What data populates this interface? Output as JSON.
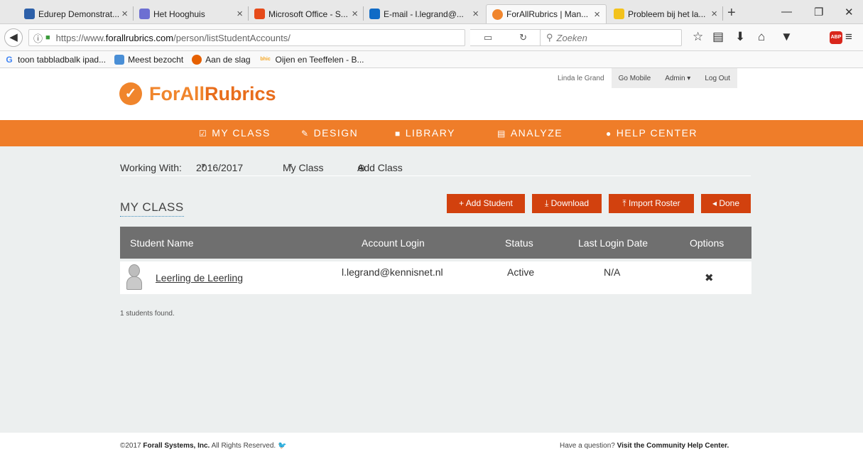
{
  "browser": {
    "tabs": [
      {
        "title": "Edurep Demonstrat...",
        "icon": "edurep-icon",
        "color": "#2c5fa8"
      },
      {
        "title": "Het Hooghuis",
        "icon": "hooghuis-icon",
        "color": "#6d6fd2"
      },
      {
        "title": "Microsoft Office - S...",
        "icon": "office-icon",
        "color": "#e64a19"
      },
      {
        "title": "E-mail - l.legrand@...",
        "icon": "outlook-icon",
        "color": "#0f6bc6"
      },
      {
        "title": "ForAllRubrics | Man...",
        "icon": "forallrubrics-icon",
        "color": "#f0852c"
      },
      {
        "title": "Probleem bij het la...",
        "icon": "warning-icon",
        "color": "#f3c21c"
      }
    ],
    "new_tab": "+",
    "url_prefix": "https://www.",
    "url_domain": "forallrubrics.com",
    "url_path": "/person/listStudentAccounts/",
    "search_placeholder": "Zoeken",
    "abp_label": "ABP",
    "bookmarks": [
      {
        "label": "toon tabbladbalk ipad...",
        "icon": "google-icon",
        "glyph": "G",
        "color": "#4285f4"
      },
      {
        "label": "Meest bezocht",
        "icon": "most-visited-icon",
        "glyph": "",
        "color": "#4a8fd6"
      },
      {
        "label": "Aan de slag",
        "icon": "firefox-icon",
        "glyph": "",
        "color": "#e66000"
      },
      {
        "label": "Oijen en Teeffelen - B...",
        "icon": "bhic-icon",
        "glyph": "bhic",
        "color": "#f5a623"
      }
    ]
  },
  "site": {
    "logo_part1": "ForAll",
    "logo_part2": "Rubrics",
    "user_name": "Linda le Grand",
    "go_mobile": "Go Mobile",
    "admin": "Admin ▾",
    "log_out": "Log Out",
    "nav": [
      {
        "label": "MY CLASS",
        "icon": "checkbox-icon",
        "glyph": "☑"
      },
      {
        "label": "DESIGN",
        "icon": "pencil-icon",
        "glyph": "✎"
      },
      {
        "label": "LIBRARY",
        "icon": "book-icon",
        "glyph": "■"
      },
      {
        "label": "ANALYZE",
        "icon": "bar-chart-icon",
        "glyph": "▤"
      },
      {
        "label": "HELP CENTER",
        "icon": "chat-bubbles-icon",
        "glyph": "●"
      }
    ],
    "accent": "#ef7d29",
    "button_color": "#d2410e"
  },
  "toolbar": {
    "working_with_label": "Working With:",
    "year": "2016/2017",
    "class_select": "My Class",
    "add_class": "Add Class"
  },
  "section_title": "MY CLASS",
  "actions": {
    "add_student": "+ Add Student",
    "download": "⤓ Download",
    "import_roster": "⤒ Import Roster",
    "done": "◂ Done"
  },
  "table": {
    "columns": [
      "Student Name",
      "Account Login",
      "Status",
      "Last Login Date",
      "Options"
    ],
    "rows": [
      {
        "name": "Leerling de Leerling",
        "login": "l.legrand@kennisnet.nl",
        "status": "Active",
        "last_login": "N/A",
        "option": "✖"
      }
    ]
  },
  "count_text": "1 students found.",
  "footer": {
    "copyright_prefix": "©2017 ",
    "company": "Forall Systems, Inc.",
    "rights": " All Rights Reserved.",
    "question": "Have a question? ",
    "help_link": "Visit the Community Help Center."
  }
}
